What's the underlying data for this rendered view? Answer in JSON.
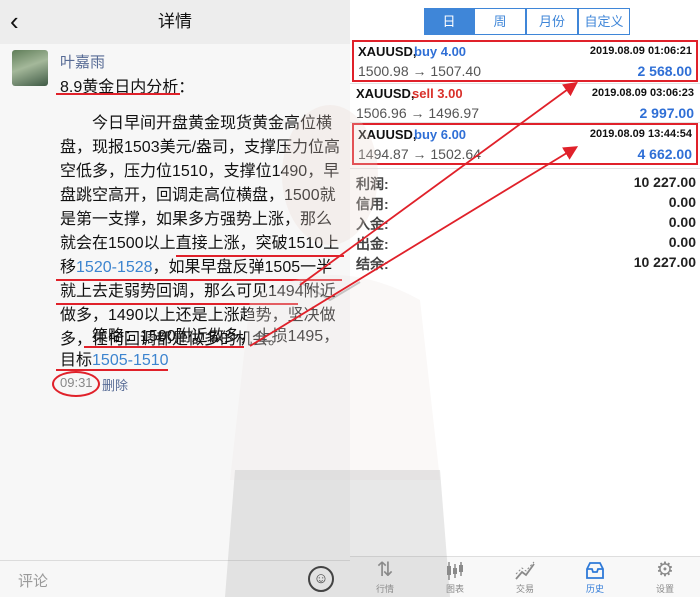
{
  "left": {
    "nav_title": "详情",
    "back_icon": "chevron-left-icon",
    "author": "叶嘉雨",
    "post_title": "8.9黄金日内分析：",
    "body_part1": "今日早间开盘黄金现货黄金高位横盘，现报1503美元/盎司，支撑压力位高空低多，压力位1510，支撑位1490，早盘跳空高开，回调走高位横盘，1500就是第一支撑，如果多方强势上涨，那么就会在1500以上直接上涨，突破1510上移",
    "body_hl1": "1520-1528",
    "body_part2": "，如果早盘反弹1505一半就上去走弱势回调，那么可见1494附近做多，1490以上还是上涨趋势，坚决做多，任何回调都是做多的机会。",
    "strategy_part1": "策略：1500附近做多，止损1495，目标",
    "strategy_hl": "1505-1510",
    "time": "09:31",
    "delete_label": "删除",
    "comment_placeholder": "评论",
    "emoji_icon": "emoji-icon"
  },
  "right": {
    "segments": [
      "日",
      "周",
      "月份",
      "自定义"
    ],
    "active_segment": "日",
    "orders": [
      {
        "symbol": "XAUUSD,",
        "direction": "buy 4.00",
        "date": "2019.08.09 01:06:21",
        "price": "1500.98 → 1507.40",
        "profit": "2 568.00",
        "highlighted": true
      },
      {
        "symbol": "XAUUSD,",
        "direction": "sell 3.00",
        "date": "2019.08.09 03:06:23",
        "price": "1506.96 → 1496.97",
        "profit": "2 997.00",
        "highlighted": false
      },
      {
        "symbol": "XAUUSD,",
        "direction": "buy 6.00",
        "date": "2019.08.09 13:44:54",
        "price": "1494.87 → 1502.64",
        "profit": "4 662.00",
        "highlighted": true
      }
    ],
    "summary": [
      {
        "label": "利润:",
        "value": "10 227.00"
      },
      {
        "label": "信用:",
        "value": "0.00"
      },
      {
        "label": "入金:",
        "value": "0.00"
      },
      {
        "label": "出金:",
        "value": "0.00"
      },
      {
        "label": "结余:",
        "value": "10 227.00"
      }
    ],
    "tabs": [
      {
        "label": "行情",
        "icon": "arrows-updown-icon"
      },
      {
        "label": "图表",
        "icon": "candlestick-icon"
      },
      {
        "label": "交易",
        "icon": "trend-line-icon"
      },
      {
        "label": "历史",
        "icon": "inbox-tray-icon"
      },
      {
        "label": "设置",
        "icon": "gear-icon"
      }
    ],
    "active_tab": "历史"
  },
  "colors": {
    "accent_blue": "#3f86d8",
    "buy_blue": "#2f6fd6",
    "sell_red": "#d9302a",
    "annotation_red": "#e0212a",
    "link_blue": "#576b95"
  }
}
